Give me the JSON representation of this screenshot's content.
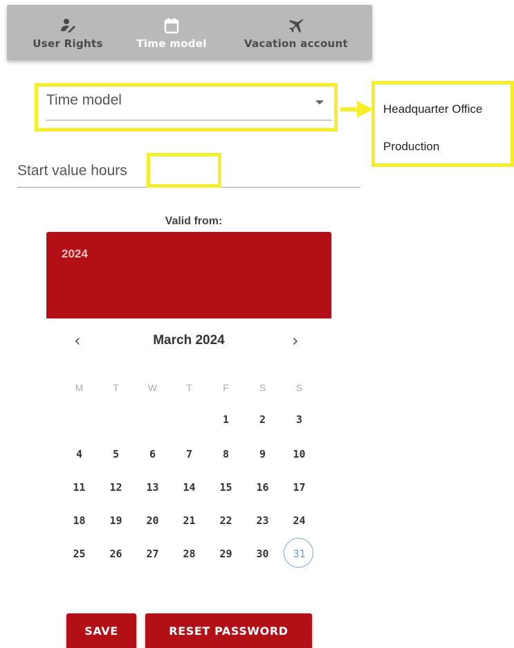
{
  "tabs": [
    {
      "label": "User Rights",
      "icon": "user-rights-icon",
      "active": false
    },
    {
      "label": "Time model",
      "icon": "calendar-icon",
      "active": true
    },
    {
      "label": "Vacation account",
      "icon": "airplane-icon",
      "active": false
    }
  ],
  "time_model": {
    "value": "Time model",
    "options": [
      "Headquarter Office",
      "Production"
    ]
  },
  "start_value": {
    "label": "Start value hours",
    "value": ""
  },
  "date_picker": {
    "title": "Valid from:",
    "year": "2024",
    "month_label": "March 2024",
    "weekdays": [
      "M",
      "T",
      "W",
      "T",
      "F",
      "S",
      "S"
    ],
    "weeks": [
      [
        "",
        "",
        "",
        "",
        "1",
        "2",
        "3"
      ],
      [
        "4",
        "5",
        "6",
        "7",
        "8",
        "9",
        "10"
      ],
      [
        "11",
        "12",
        "13",
        "14",
        "15",
        "16",
        "17"
      ],
      [
        "18",
        "19",
        "20",
        "21",
        "22",
        "23",
        "24"
      ],
      [
        "25",
        "26",
        "27",
        "28",
        "29",
        "30",
        "31"
      ]
    ],
    "today": "31"
  },
  "buttons": {
    "save": "SAVE",
    "reset_password": "RESET PASSWORD"
  },
  "colors": {
    "accent": "#b21016",
    "highlight": "#f5ee2a",
    "today_ring": "#7aa8d8",
    "tabbar": "#b9b9b9"
  }
}
